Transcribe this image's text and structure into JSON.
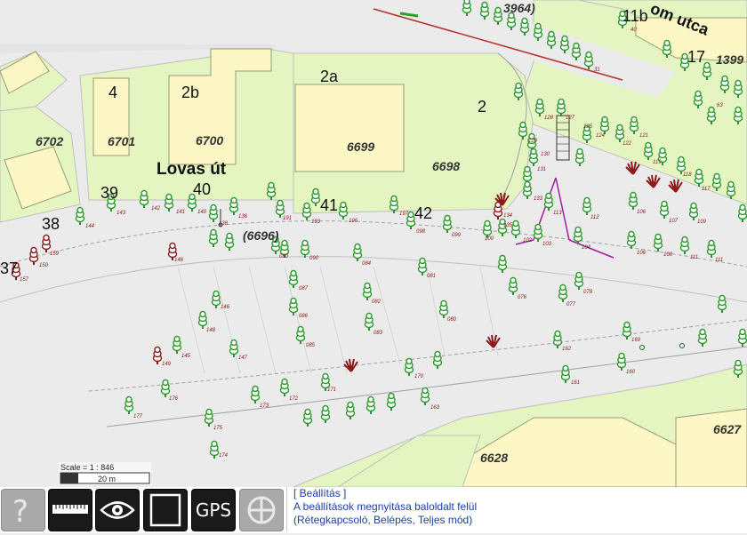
{
  "map": {
    "street_labels": [
      "Lovas út",
      "om utca"
    ],
    "parcel_labels": [
      "6702",
      "6701",
      "6700",
      "6699",
      "6698",
      "6628",
      "6627",
      "(6696)",
      "(3964)",
      "1399"
    ],
    "house_numbers": [
      "4",
      "2b",
      "2a",
      "2",
      "39",
      "40",
      "41",
      "42",
      "38",
      "37",
      "11b",
      "17"
    ],
    "colors": {
      "base": "#ebebeb",
      "parcel_green": "#e5f5c2",
      "building": "#fcf7c4",
      "tree_green": "#2a9a2a",
      "tree_dark_red": "#8b1a1a",
      "path_magenta": "#a020a0"
    }
  },
  "scale": {
    "label": "Scale = 1 : 846",
    "distance": "20 m"
  },
  "toolbar": {
    "buttons": [
      {
        "name": "help-button",
        "icon": "question-icon"
      },
      {
        "name": "measure-button",
        "icon": "ruler-icon"
      },
      {
        "name": "view-button",
        "icon": "eye-icon"
      },
      {
        "name": "fullscreen-button",
        "icon": "frame-icon"
      },
      {
        "name": "gps-button",
        "label": "GPS"
      },
      {
        "name": "pan-button",
        "icon": "crosshair-icon"
      }
    ]
  },
  "info": {
    "link": "[ Beállítás ]",
    "line1": "A beállítások megnyitása baloldalt felül",
    "line2": "(Rétegkapcsoló, Belépés, Teljes mód)"
  }
}
